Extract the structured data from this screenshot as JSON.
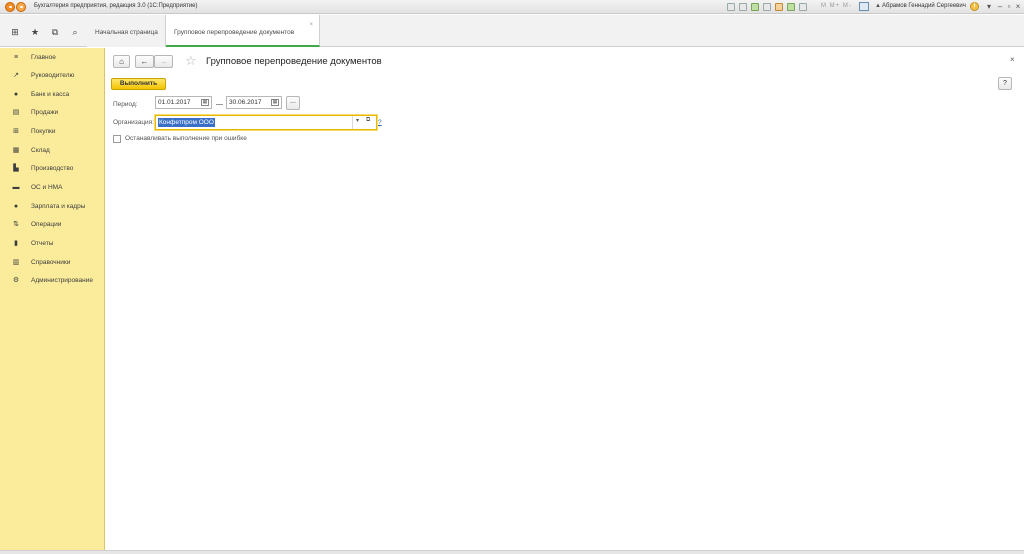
{
  "window": {
    "title": "Бухгалтерия предприятия, редакция 3.0 (1С:Предприятие)",
    "tb_text": "M M+ M-",
    "user": "Абрамов Геннадий Сергеевич"
  },
  "toolbar": {
    "home_tab": "Начальная страница",
    "active_tab": "Групповое перепроведение документов",
    "active_tab_close": "×"
  },
  "sidebar": {
    "items": [
      {
        "label": "Главное",
        "icon": "≡"
      },
      {
        "label": "Руководителю",
        "icon": "↗"
      },
      {
        "label": "Банк и касса",
        "icon": "●"
      },
      {
        "label": "Продажи",
        "icon": "▤"
      },
      {
        "label": "Покупки",
        "icon": "⊞"
      },
      {
        "label": "Склад",
        "icon": "▦"
      },
      {
        "label": "Производство",
        "icon": "▙"
      },
      {
        "label": "ОС и НМА",
        "icon": "▬"
      },
      {
        "label": "Зарплата и кадры",
        "icon": "●"
      },
      {
        "label": "Операции",
        "icon": "⇅"
      },
      {
        "label": "Отчеты",
        "icon": "▮"
      },
      {
        "label": "Справочники",
        "icon": "▥"
      },
      {
        "label": "Администрирование",
        "icon": "⚙"
      }
    ]
  },
  "form": {
    "title": "Групповое перепроведение документов",
    "close": "×",
    "help": "?",
    "run_button": "Выполнить",
    "period_label": "Период:",
    "date_from": "01.01.2017",
    "date_to": "30.06.2017",
    "dash": "—",
    "dots": "...",
    "org_label": "Организация:",
    "org_value": "Конфетпром ООО",
    "org_help": "?",
    "stop_on_error": "Останавливать выполнение при ошибке"
  }
}
